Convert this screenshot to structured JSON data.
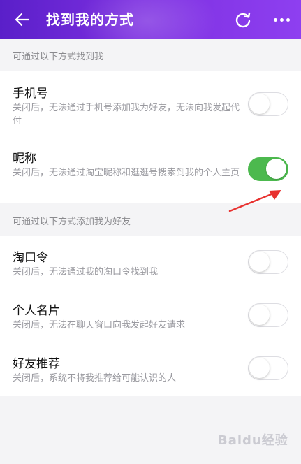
{
  "header": {
    "title": "找到我的方式",
    "back_icon": "back-arrow-icon",
    "refresh_icon": "refresh-icon",
    "more_icon": "more-dots-icon"
  },
  "sections": [
    {
      "header": "可通过以下方式找到我",
      "items": [
        {
          "title": "手机号",
          "desc": "关闭后，无法通过手机号添加我为好友，无法向我发起代付",
          "enabled": false
        },
        {
          "title": "昵称",
          "desc": "关闭后，无法通过淘宝昵称和逛逛号搜索到我的个人主页",
          "enabled": true
        }
      ]
    },
    {
      "header": "可通过以下方式添加我为好友",
      "items": [
        {
          "title": "淘口令",
          "desc": "关闭后，无法通过我的淘口令找到我",
          "enabled": false
        },
        {
          "title": "个人名片",
          "desc": "关闭后，无法在聊天窗口向我发起好友请求",
          "enabled": false
        },
        {
          "title": "好友推荐",
          "desc": "关闭后，系统不将我推荐给可能认识的人",
          "enabled": false
        }
      ]
    }
  ],
  "colors": {
    "header_start": "#5a1fc9",
    "header_end": "#8e3ff0",
    "toggle_on": "#4cb94e",
    "annotation_arrow": "#e8312f"
  },
  "watermark": "Baidu经验"
}
